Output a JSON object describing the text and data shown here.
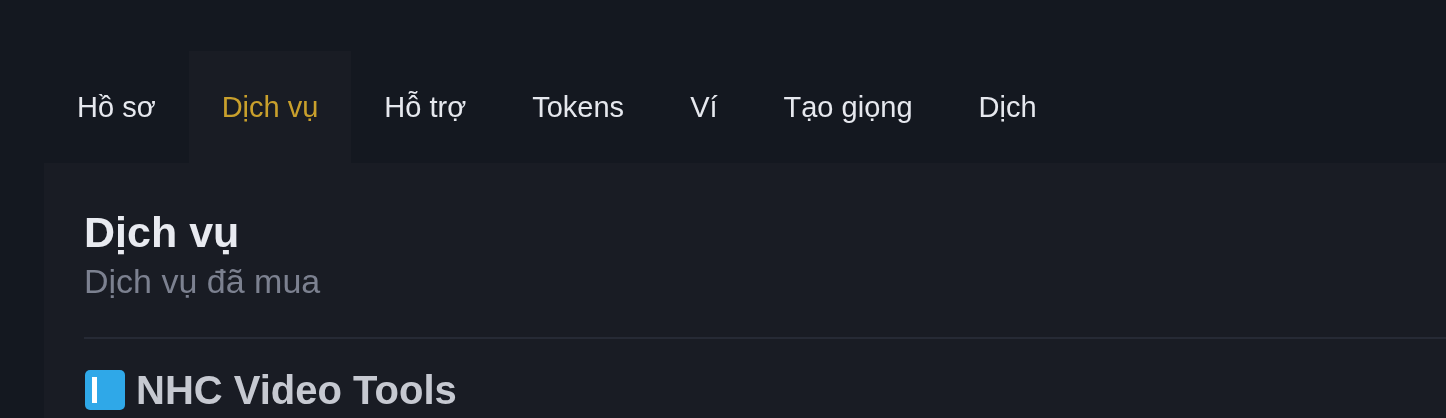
{
  "tabs": [
    {
      "label": "Hồ sơ",
      "selected": false
    },
    {
      "label": "Dịch vụ",
      "selected": true
    },
    {
      "label": "Hỗ trợ",
      "selected": false
    },
    {
      "label": "Tokens",
      "selected": false
    },
    {
      "label": "Ví",
      "selected": false
    },
    {
      "label": "Tạo giọng",
      "selected": false
    },
    {
      "label": "Dịch",
      "selected": false
    }
  ],
  "panel": {
    "title": "Dịch vụ",
    "subtitle": "Dịch vụ đã mua",
    "section_title": "NHC Video Tools"
  }
}
